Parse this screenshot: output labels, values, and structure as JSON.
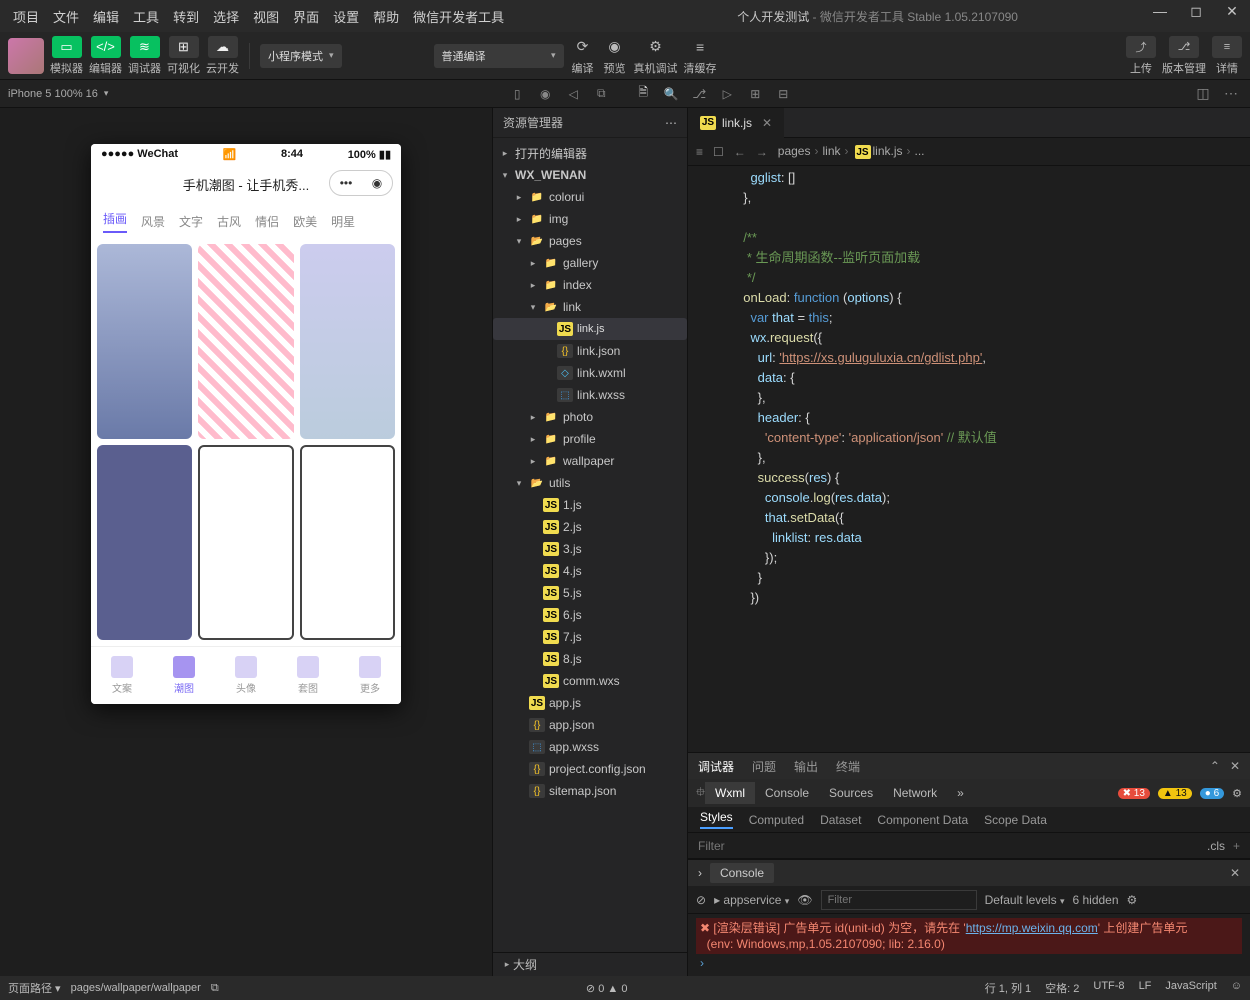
{
  "menu": {
    "items": [
      "项目",
      "文件",
      "编辑",
      "工具",
      "转到",
      "选择",
      "视图",
      "界面",
      "设置",
      "帮助",
      "微信开发者工具"
    ],
    "project": "个人开发测试",
    "app": "微信开发者工具 Stable 1.05.2107090"
  },
  "toolbar": {
    "sim": "模拟器",
    "editor": "编辑器",
    "dbg": "调试器",
    "viz": "可视化",
    "cloud": "云开发",
    "mode": "小程序模式",
    "compile_sel": "普通编译",
    "compile": "编译",
    "preview": "预览",
    "remote": "真机调试",
    "clear": "清缓存",
    "upload": "上传",
    "ver": "版本管理",
    "detail": "详情"
  },
  "devbar": {
    "label": "iPhone 5 100% 16"
  },
  "sim": {
    "carrier": "●●●●● WeChat",
    "time": "8:44",
    "battery": "100%",
    "title": "手机潮图 - 让手机秀...",
    "tabs": [
      "插画",
      "风景",
      "文字",
      "古风",
      "情侣",
      "欧美",
      "明星"
    ],
    "nav": [
      "文案",
      "潮图",
      "头像",
      "套图",
      "更多"
    ]
  },
  "explorer": {
    "title": "资源管理器",
    "root": "WX_WENAN",
    "openEditors": "打开的编辑器",
    "folders": {
      "colorui": "colorui",
      "img": "img",
      "pages": "pages",
      "gallery": "gallery",
      "index": "index",
      "link": "link",
      "photo": "photo",
      "profile": "profile",
      "wallpaper": "wallpaper",
      "utils": "utils"
    },
    "link": {
      "js": "link.js",
      "json": "link.json",
      "wxml": "link.wxml",
      "wxss": "link.wxss"
    },
    "utils": [
      "1.js",
      "2.js",
      "3.js",
      "4.js",
      "5.js",
      "6.js",
      "7.js",
      "8.js",
      "comm.wxs"
    ],
    "root_files": {
      "appjs": "app.js",
      "appjson": "app.json",
      "appwxss": "app.wxss",
      "proj": "project.config.json",
      "sitemap": "sitemap.json"
    },
    "outline": "大纲"
  },
  "editor": {
    "tab": "link.js",
    "crumbs": [
      "pages",
      "link",
      "link.js",
      "..."
    ],
    "lines": [
      "",
      "",
      "",
      "",
      "",
      "",
      "",
      "",
      "",
      "",
      "",
      "",
      "",
      "",
      "",
      "",
      "",
      "",
      "",
      "",
      ""
    ],
    "code": {
      "gglist": "gglist",
      "comment1": "/**",
      "comment2": " * 生命周期函数--监听页面加载",
      "comment3": " */",
      "onload": "onLoad",
      "func": "function",
      "opts": "options",
      "var": "var",
      "that": "that",
      "this": "this",
      "wx": "wx",
      "req": "request",
      "url": "url",
      "urlv": "'https://xs.guluguluxia.cn/gdlist.php'",
      "data": "data",
      "header": "header",
      "ct": "'content-type'",
      "app": "'application/json'",
      "defc": "// 默认值",
      "succ": "success",
      "res": "res",
      "cons": "console",
      "log": "log",
      "resd": "res.data",
      "setd": "setData",
      "ll": "linklist",
      "rd": "res.data"
    }
  },
  "debugger": {
    "tabs": [
      "调试器",
      "问题",
      "输出",
      "终端"
    ],
    "dev": [
      "Wxml",
      "Console",
      "Sources",
      "Network"
    ],
    "counts": {
      "err": "13",
      "warn": "13",
      "info": "6"
    },
    "styles": [
      "Styles",
      "Computed",
      "Dataset",
      "Component Data",
      "Scope Data"
    ],
    "filter": "Filter",
    "cls": ".cls"
  },
  "console": {
    "title": "Console",
    "context": "appservice",
    "levels": "Default levels",
    "hidden": "6 hidden",
    "filter": "Filter",
    "err1": "[渲染层错误] 广告单元 id(unit-id) 为空，请先在 '",
    "errlink": "https://mp.weixin.qq.com",
    "err1b": "' 上创建广告单元",
    "env": "(env: Windows,mp,1.05.2107090; lib: 2.16.0)"
  },
  "status": {
    "pathlabel": "页面路径",
    "path": "pages/wallpaper/wallpaper",
    "errwarn": "0",
    "ln": "行 1, 列 1",
    "spaces": "空格: 2",
    "enc": "UTF-8",
    "eol": "LF",
    "lang": "JavaScript"
  }
}
